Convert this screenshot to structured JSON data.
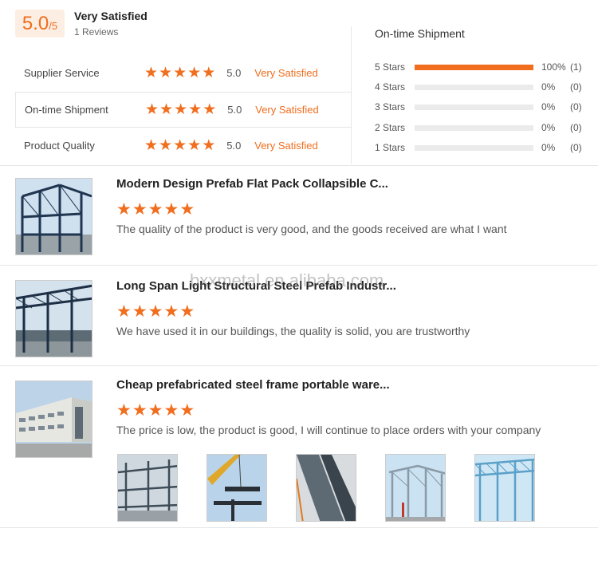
{
  "summary": {
    "score": "5.0",
    "score_denominator": "/5",
    "label": "Very Satisfied",
    "reviews": "1 Reviews"
  },
  "metrics": [
    {
      "label": "Supplier Service",
      "stars": 5,
      "score": "5.0",
      "description": "Very Satisfied"
    },
    {
      "label": "On-time Shipment",
      "stars": 5,
      "score": "5.0",
      "description": "Very Satisfied"
    },
    {
      "label": "Product Quality",
      "stars": 5,
      "score": "5.0",
      "description": "Very Satisfied"
    }
  ],
  "distribution": {
    "title": "On-time Shipment",
    "rows": [
      {
        "label": "5  Stars",
        "fraction": 1.0,
        "percent": "100%",
        "count": "(1)"
      },
      {
        "label": "4  Stars",
        "fraction": 0.0,
        "percent": "0%",
        "count": "(0)"
      },
      {
        "label": "3  Stars",
        "fraction": 0.0,
        "percent": "0%",
        "count": "(0)"
      },
      {
        "label": "2  Stars",
        "fraction": 0.0,
        "percent": "0%",
        "count": "(0)"
      },
      {
        "label": "1  Stars",
        "fraction": 0.0,
        "percent": "0%",
        "count": "(0)"
      }
    ]
  },
  "products": [
    {
      "title": "Modern Design Prefab Flat Pack Collapsible C...",
      "stars": 5,
      "review": "The quality of the product is very good, and the goods received are what I want"
    },
    {
      "title": "Long Span Light Structural Steel Prefab Industr...",
      "stars": 5,
      "review": "We have used it in our buildings, the quality is solid, you are trustworthy"
    },
    {
      "title": "Cheap prefabricated steel frame portable ware...",
      "stars": 5,
      "review": "The price is low, the product is good, I will continue to place orders with your company"
    }
  ],
  "watermark": "bxxmetal.en.alibaba.com",
  "colors": {
    "accent": "#f06e1e",
    "badge_bg": "#fdeee4",
    "track": "#ebebeb"
  }
}
